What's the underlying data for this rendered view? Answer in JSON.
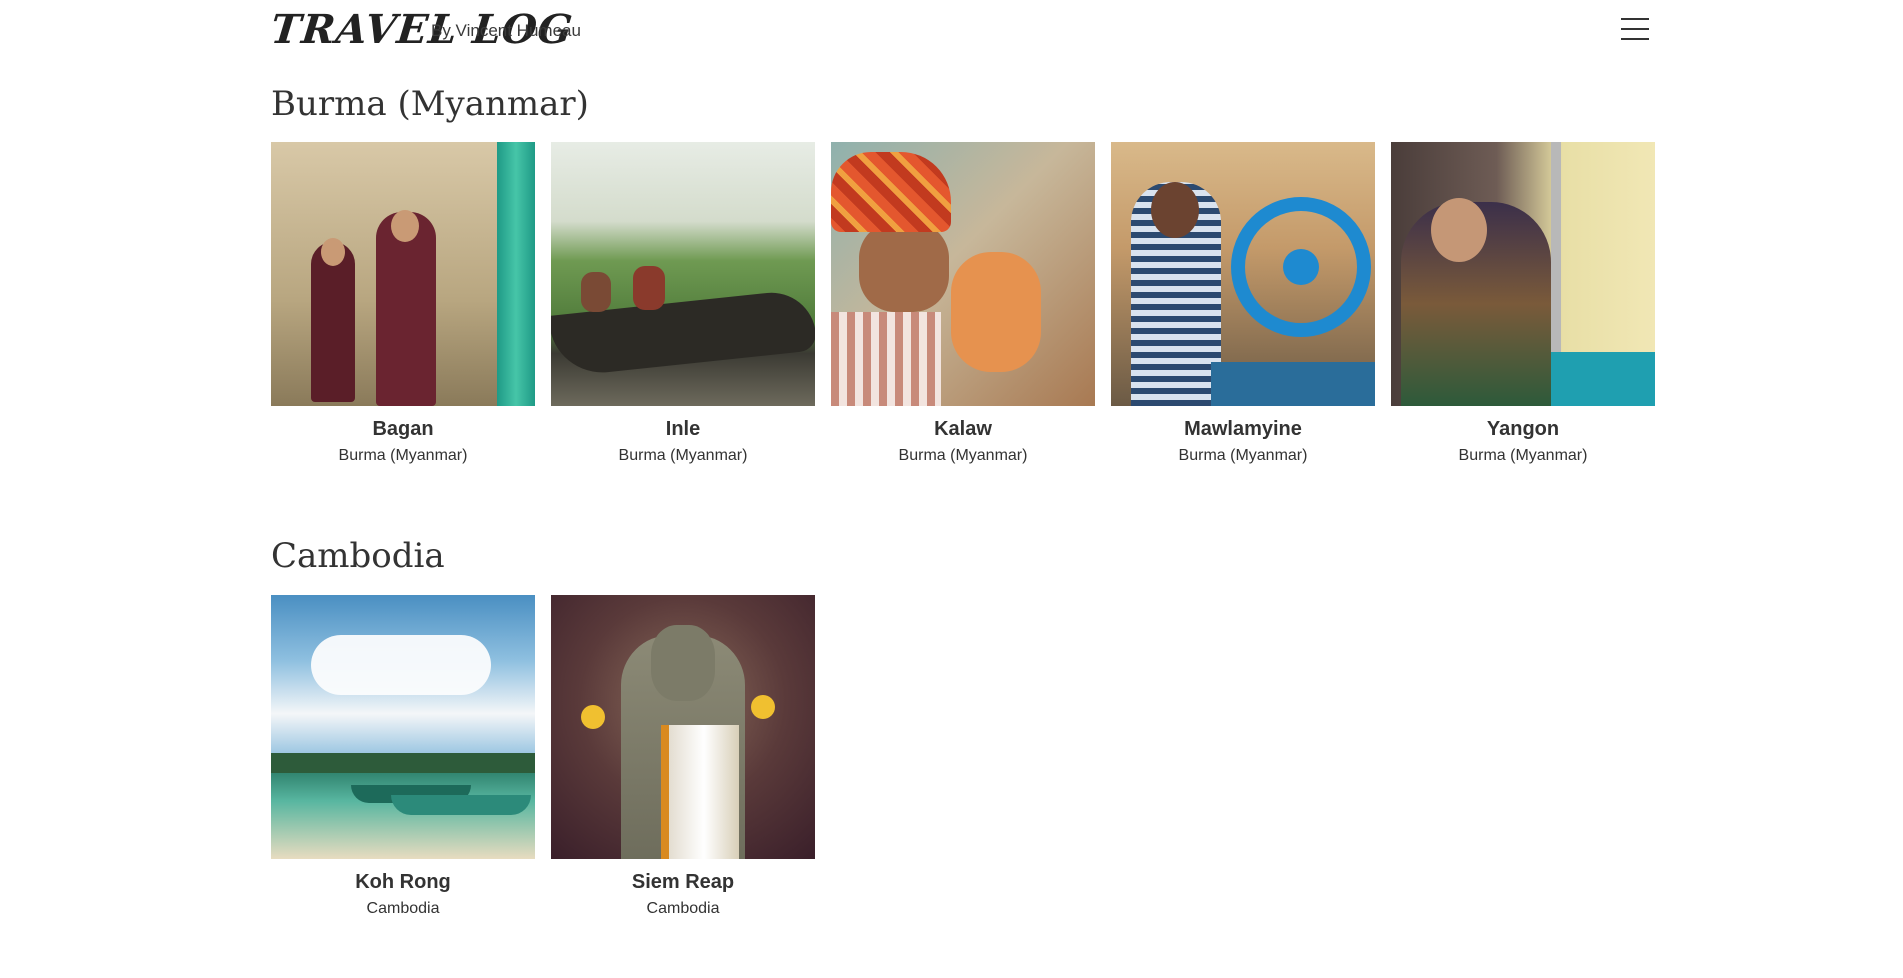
{
  "header": {
    "logo": "TRAVEL LOG",
    "byline": "By Vincent Humeau",
    "menu_icon": "hamburger-menu-icon"
  },
  "sections": [
    {
      "title": "Burma (Myanmar)",
      "cards": [
        {
          "title": "Bagan",
          "subtitle": "Burma (Myanmar)"
        },
        {
          "title": "Inle",
          "subtitle": "Burma (Myanmar)"
        },
        {
          "title": "Kalaw",
          "subtitle": "Burma (Myanmar)"
        },
        {
          "title": "Mawlamyine",
          "subtitle": "Burma (Myanmar)"
        },
        {
          "title": "Yangon",
          "subtitle": "Burma (Myanmar)"
        }
      ]
    },
    {
      "title": "Cambodia",
      "cards": [
        {
          "title": "Koh Rong",
          "subtitle": "Cambodia"
        },
        {
          "title": "Siem Reap",
          "subtitle": "Cambodia"
        }
      ]
    }
  ]
}
